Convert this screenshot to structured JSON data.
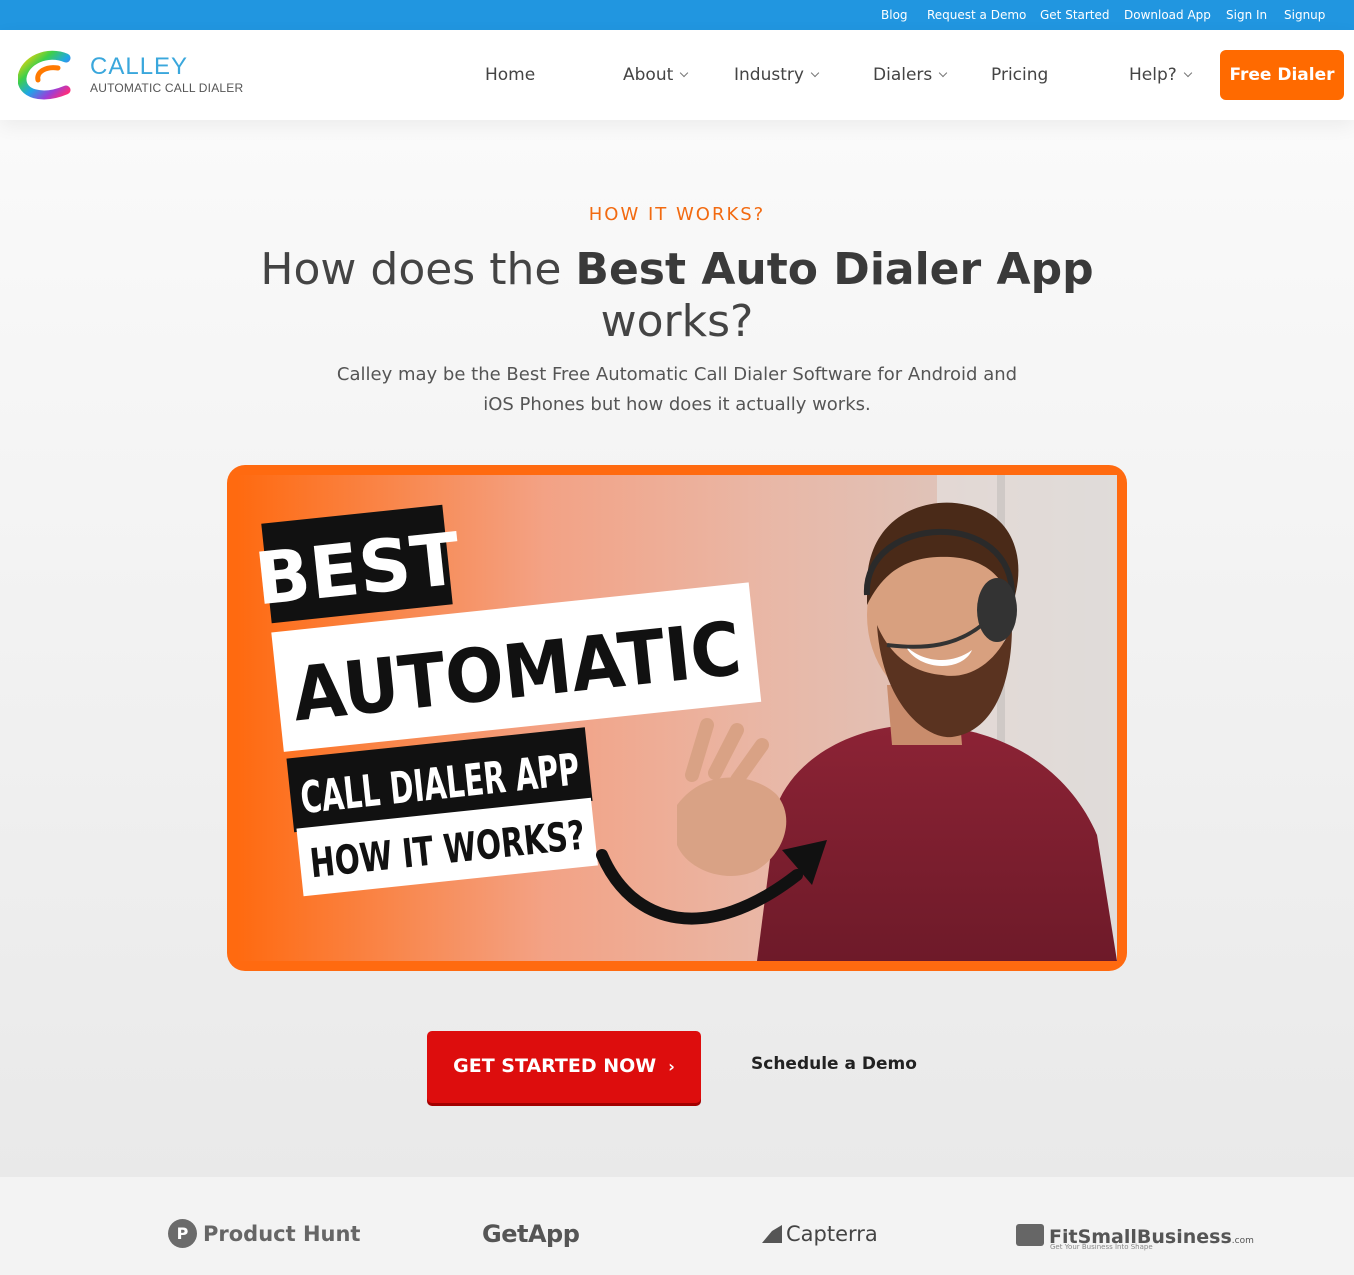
{
  "topbar": {
    "links": [
      "Blog",
      "Request a Demo",
      "Get Started",
      "Download App",
      "Sign In",
      "Signup"
    ]
  },
  "brand": {
    "name": "CALLEY",
    "tagline": "AUTOMATIC CALL DIALER"
  },
  "nav": {
    "items": [
      {
        "label": "Home",
        "dropdown": false
      },
      {
        "label": "About",
        "dropdown": true
      },
      {
        "label": "Industry",
        "dropdown": true
      },
      {
        "label": "Dialers",
        "dropdown": true
      },
      {
        "label": "Pricing",
        "dropdown": false
      },
      {
        "label": "Help?",
        "dropdown": true
      }
    ],
    "cta_label": "Free Dialer"
  },
  "hero": {
    "eyebrow": "HOW IT WORKS?",
    "headline_pre": "How does the ",
    "headline_bold": "Best Auto Dialer App",
    "headline_post": " works?",
    "subheading": "Calley may be the Best Free Automatic Call Dialer Software for Android and iOS Phones but how does it actually works.",
    "thumbnail_text": {
      "line1": "BEST",
      "line2": "AUTOMATIC",
      "line3": "CALL DIALER APP",
      "line4": "HOW IT WORKS?"
    },
    "primary_button": "GET STARTED NOW",
    "secondary_link": "Schedule a Demo"
  },
  "reviews": {
    "sites": [
      {
        "name": "Product Hunt",
        "badge": "P"
      },
      {
        "name": "GetApp"
      },
      {
        "name": "Capterra"
      },
      {
        "name": "FitSmallBusiness",
        "suffix": ".com",
        "tagline": "Get Your Business Into Shape"
      }
    ]
  },
  "colors": {
    "topbar": "#2196e0",
    "accent_orange": "#ff6a00",
    "cta_red": "#dd0d0d",
    "eyebrow": "#f26a10"
  }
}
